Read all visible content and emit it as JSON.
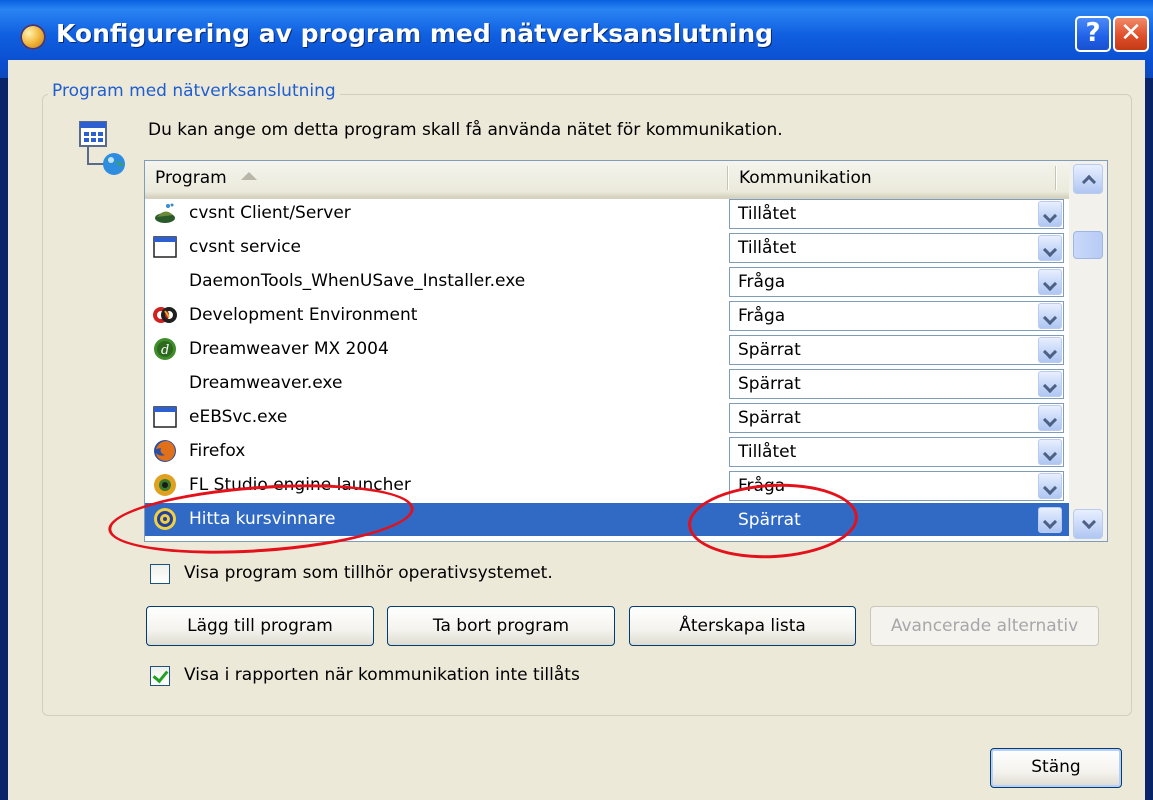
{
  "window": {
    "title": "Konfigurering av program med nätverksanslutning",
    "help_label": "?",
    "close_label": "✕"
  },
  "group": {
    "title": "Program med nätverksanslutning",
    "description": "Du kan ange om detta program skall få använda nätet för kommunikation."
  },
  "list": {
    "columns": [
      "Program",
      "Kommunikation"
    ],
    "rows": [
      {
        "name": "cvsnt Client/Server",
        "value": "Tillåtet",
        "icon": "cvsnt-icon"
      },
      {
        "name": "cvsnt service",
        "value": "Tillåtet",
        "icon": "window-icon"
      },
      {
        "name": "DaemonTools_WhenUSave_Installer.exe",
        "value": "Fråga",
        "icon": "none"
      },
      {
        "name": "Development Environment",
        "value": "Fråga",
        "icon": "devenv-icon"
      },
      {
        "name": "Dreamweaver MX 2004",
        "value": "Spärrat",
        "icon": "dreamweaver-icon"
      },
      {
        "name": "Dreamweaver.exe",
        "value": "Spärrat",
        "icon": "none"
      },
      {
        "name": "eEBSvc.exe",
        "value": "Spärrat",
        "icon": "window-icon"
      },
      {
        "name": "Firefox",
        "value": "Tillåtet",
        "icon": "firefox-icon"
      },
      {
        "name": "FL Studio engine launcher",
        "value": "Fråga",
        "icon": "flstudio-icon"
      },
      {
        "name": "Hitta kursvinnare",
        "value": "Spärrat",
        "icon": "hitta-icon",
        "selected": true
      }
    ]
  },
  "options": {
    "show_os_programs": {
      "label": "Visa program som tillhör operativsystemet.",
      "checked": false
    },
    "report_blocked": {
      "label": "Visa i rapporten när kommunikation inte tillåts",
      "checked": true
    }
  },
  "buttons": {
    "add": "Lägg till program",
    "remove": "Ta bort program",
    "restore": "Återskapa lista",
    "advanced": "Avancerade alternativ",
    "close": "Stäng"
  },
  "colors": {
    "title_bar": "#0a5fe0",
    "selection": "#316ac5",
    "annotation": "#e4101a",
    "group_title": "#1f5ecf"
  }
}
